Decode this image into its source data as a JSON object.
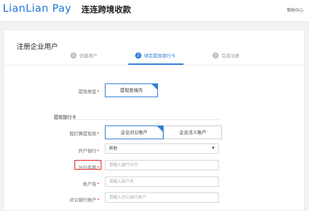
{
  "header": {
    "logo": "LianLian Pay",
    "brand": "连连跨境收款",
    "help": "帮助中心"
  },
  "page": {
    "title": "注册企业用户"
  },
  "steps": [
    {
      "num": "1",
      "label": "创建用户"
    },
    {
      "num": "2",
      "label": "绑定提现银行卡"
    },
    {
      "num": "3",
      "label": "完成注册"
    }
  ],
  "form": {
    "withdraw_type": {
      "label": "提现类型",
      "required": "*",
      "option": "提现至境内"
    },
    "section_title": "提现银行卡",
    "withdraw_to": {
      "label": "我打算提现到",
      "required": "*",
      "options": [
        "企业对公账户",
        "企业法人账户"
      ]
    },
    "bank": {
      "label": "开户银行",
      "required": "*",
      "value": "其他"
    },
    "branch": {
      "label": "分行名称",
      "required": "*",
      "placeholder": "请输入银行分行"
    },
    "account_name": {
      "label": "账户名",
      "required": "*",
      "placeholder": "请输入账户名"
    },
    "account_no": {
      "label": "对公银行账户",
      "required": "*",
      "placeholder": "请输入对公银行账户"
    }
  },
  "colors": {
    "accent": "#2f7fd8",
    "required": "#e23b3b",
    "highlight": "#e02020"
  },
  "icons": {
    "dropdown": "chevron-down-icon"
  }
}
